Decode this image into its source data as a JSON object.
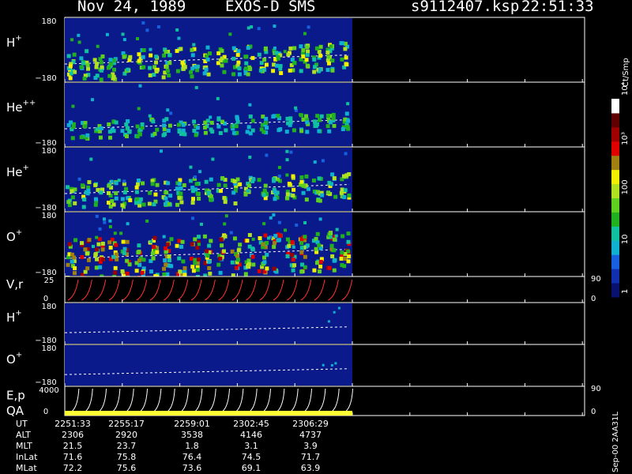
{
  "header": {
    "date": "Nov 24, 1989",
    "instrument": "EXOS-D SMS",
    "filename": "s9112407.ksp",
    "time": "22:51:33"
  },
  "colors": {
    "background": "#000000",
    "plot_bg": "#0a1a8a",
    "overlay_dash": "#ffffff",
    "vr_curve": "#ff3030",
    "ep_curve": "#ffffff",
    "qa_bar": "#ffff33"
  },
  "colorbar": {
    "unit": "Ct/Smp",
    "ticks": [
      "1",
      "10",
      "100",
      "10³",
      "10⁴"
    ],
    "scale": "log",
    "range": [
      1,
      10000
    ],
    "colors": [
      "#081070",
      "#1030b0",
      "#1860e0",
      "#10b0d0",
      "#10c0a0",
      "#20b020",
      "#60d020",
      "#b0e020",
      "#f0f000",
      "#a08010",
      "#e00000",
      "#a00000",
      "#600000",
      "#ffffff"
    ]
  },
  "panels": [
    {
      "id": "h-plus-top",
      "species": "H",
      "charge": "+",
      "ymax": "180",
      "ymin": "−180"
    },
    {
      "id": "he-plus-plus",
      "species": "He",
      "charge": "++",
      "ymax": "",
      "ymin": "−180"
    },
    {
      "id": "he-plus",
      "species": "He",
      "charge": "+",
      "ymax": "180",
      "ymin": "−180"
    },
    {
      "id": "o-plus-top",
      "species": "O",
      "charge": "+",
      "ymax": "180",
      "ymin": "−180"
    },
    {
      "id": "vr",
      "species": "V,r",
      "charge": "",
      "ymax": "25",
      "ymin": "0",
      "right_top": "90",
      "right_bottom": "0"
    },
    {
      "id": "h-plus-bottom",
      "species": "H",
      "charge": "+",
      "ymax": "180",
      "ymin": "−180"
    },
    {
      "id": "o-plus-bottom",
      "species": "O",
      "charge": "+",
      "ymax": "180",
      "ymin": "−180"
    },
    {
      "id": "ep",
      "species": "E,p",
      "charge": "",
      "ymax": "4000",
      "ymin": "0",
      "right_top": "90",
      "right_bottom": "0"
    }
  ],
  "qa_label": "QA",
  "chart_data": {
    "type": "heatmap",
    "title": "Nov 24, 1989   EXOS-D SMS",
    "x_label": "UT",
    "x_ticks": [
      "2251:33",
      "2255:17",
      "2259:01",
      "2302:45",
      "2306:29"
    ],
    "y_range_angle": [
      -180,
      180
    ],
    "colorbar_range_counts": [
      1,
      10000
    ],
    "colorbar_scale": "log",
    "data_coverage_end_ut": "2308:40",
    "spin_periods_in_view": 21
  },
  "ephemeris": {
    "rows": [
      {
        "label": "UT",
        "values": [
          "2251:33",
          "2255:17",
          "2259:01",
          "2302:45",
          "2306:29"
        ]
      },
      {
        "label": "ALT",
        "values": [
          "2306",
          "2920",
          "3538",
          "4146",
          "4737"
        ]
      },
      {
        "label": "MLT",
        "values": [
          "21.5",
          "23.7",
          "1.8",
          "3.1",
          "3.9"
        ]
      },
      {
        "label": "InLat",
        "values": [
          "71.6",
          "75.8",
          "76.4",
          "74.5",
          "71.7"
        ]
      },
      {
        "label": "MLat",
        "values": [
          "72.2",
          "75.6",
          "73.6",
          "69.1",
          "63.9"
        ]
      }
    ]
  },
  "footer_id": "Sep-00 2AA31L"
}
